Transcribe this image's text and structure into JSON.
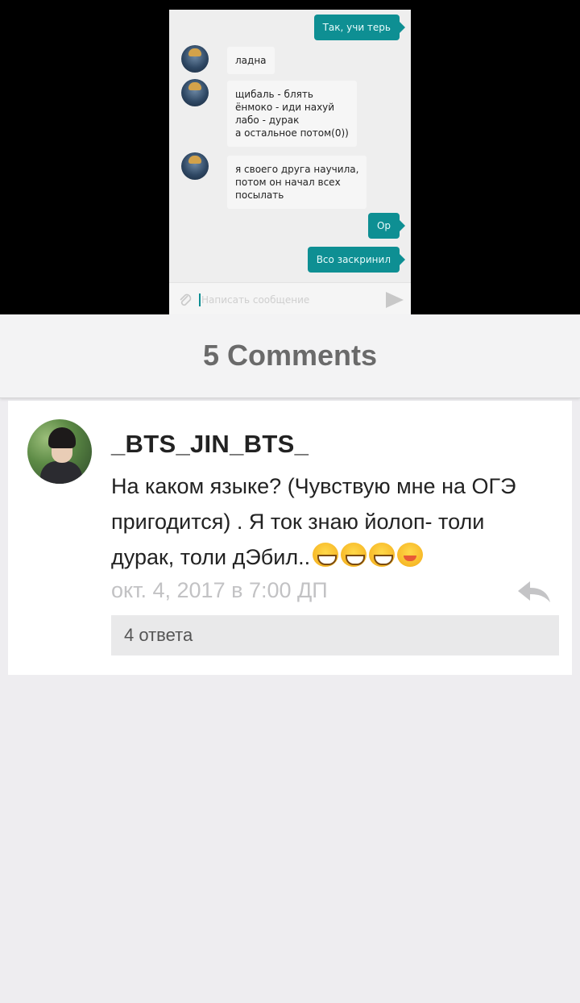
{
  "screenshot": {
    "messages": [
      {
        "side": "out",
        "text": "Так, учи терь"
      },
      {
        "side": "in",
        "text": "ладна"
      },
      {
        "side": "in",
        "text": "щибаль - блять\nёнмоко - иди нахуй\nлабо - дурак\nа остальное потом(0))"
      },
      {
        "side": "in",
        "text": "я своего друга научила,\nпотом он начал всех\nпосылать"
      },
      {
        "side": "out",
        "text": "Ор"
      },
      {
        "side": "out",
        "text": "Всо заскринил"
      }
    ],
    "composer_placeholder": "Написать сообщение",
    "accent_color": "#0e8f93"
  },
  "comments_header": {
    "title": "5 Comments"
  },
  "comment": {
    "username": "_BTS_JIN_BTS_",
    "text": "На каком языке? (Чувствую мне на ОГЭ пригодится) . Я ток знаю йолоп- толи дурак, толи дЭбил..",
    "emojis": [
      "grin",
      "grin",
      "grin",
      "smile"
    ],
    "timestamp": "окт. 4, 2017 в 7:00 ДП",
    "replies_label": "4 ответа",
    "reply_icon": "reply-icon"
  }
}
